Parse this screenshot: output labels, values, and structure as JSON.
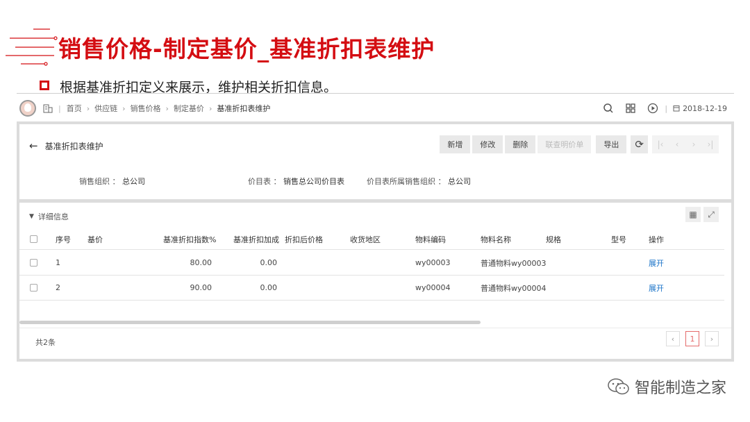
{
  "slide": {
    "title": "销售价格-制定基价_基准折扣表维护",
    "bullet": "根据基准折扣定义来展示，维护相关折扣信息。"
  },
  "topbar": {
    "breadcrumb": [
      "首页",
      "供应链",
      "销售价格",
      "制定基价",
      "基准折扣表维护"
    ],
    "date": "2018-12-19"
  },
  "header": {
    "back_icon": "back-arrow-icon",
    "title": "基准折扣表维护",
    "buttons": {
      "add": "新增",
      "edit": "修改",
      "delete": "删除",
      "price_list": "联查明价单",
      "export": "导出"
    }
  },
  "info": {
    "org_label": "销售组织",
    "org_value": "总公司",
    "pricelist_label": "价目表",
    "pricelist_value": "销售总公司价目表",
    "pricelist_org_label": "价目表所属销售组织",
    "pricelist_org_value": "总公司",
    "separator": "："
  },
  "detail": {
    "section_title": "详细信息",
    "columns": [
      "序号",
      "基价",
      "基准折扣指数%",
      "基准折扣加成",
      "折扣后价格",
      "收货地区",
      "物料编码",
      "物料名称",
      "规格",
      "型号",
      "操作"
    ],
    "rows": [
      {
        "seq": "1",
        "base": "",
        "index": "80.00",
        "addon": "0.00",
        "after": "",
        "region": "",
        "code": "wy00003",
        "name": "普通物料wy00003",
        "spec": "",
        "model": "",
        "action": "展开"
      },
      {
        "seq": "2",
        "base": "",
        "index": "90.00",
        "addon": "0.00",
        "after": "",
        "region": "",
        "code": "wy00004",
        "name": "普通物料wy00004",
        "spec": "",
        "model": "",
        "action": "展开"
      }
    ],
    "total": "共2条",
    "pager": {
      "prev": "‹",
      "current": "1",
      "next": "›"
    }
  },
  "watermark": {
    "text": "智能制造之家"
  },
  "colors": {
    "brand_red": "#d40d12",
    "link_blue": "#1a73c8"
  }
}
